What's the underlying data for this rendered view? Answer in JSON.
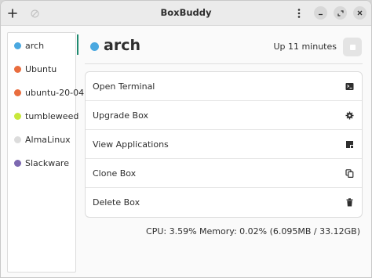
{
  "window": {
    "title": "BoxBuddy"
  },
  "sidebar": {
    "items": [
      {
        "label": "arch",
        "color": "#4aa8e0"
      },
      {
        "label": "Ubuntu",
        "color": "#e96d3e"
      },
      {
        "label": "ubuntu-20-04",
        "color": "#e96d3e"
      },
      {
        "label": "tumbleweed",
        "color": "#c8e83a"
      },
      {
        "label": "AlmaLinux",
        "color": "#dcdcdc"
      },
      {
        "label": "Slackware",
        "color": "#7c68b0"
      }
    ],
    "selected": "arch"
  },
  "main": {
    "title": "arch",
    "title_color": "#4aa8e0",
    "uptime": "Up 11 minutes",
    "actions": [
      {
        "label": "Open Terminal",
        "icon": "terminal-icon"
      },
      {
        "label": "Upgrade Box",
        "icon": "gear-icon"
      },
      {
        "label": "View Applications",
        "icon": "applications-icon"
      },
      {
        "label": "Clone Box",
        "icon": "copy-icon"
      },
      {
        "label": "Delete Box",
        "icon": "trash-icon"
      }
    ],
    "stats": "CPU: 3.59%   Memory: 0.02% (6.095MB / 33.12GB)"
  },
  "colors": {
    "accent": "#1f8a70"
  }
}
